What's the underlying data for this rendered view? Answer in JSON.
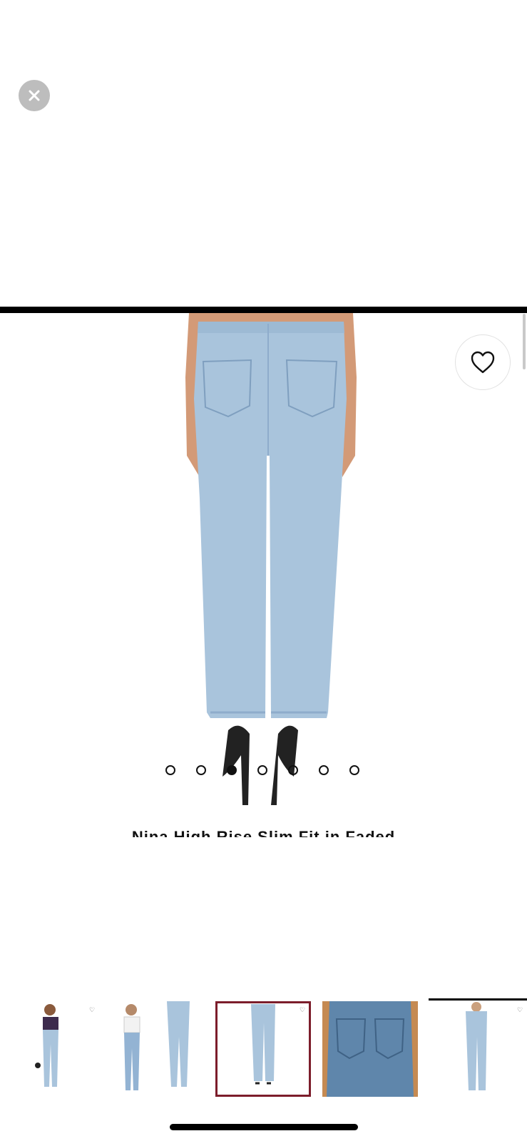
{
  "viewer": {
    "close_icon": "close-icon",
    "favorite_icon": "heart-outline-icon",
    "image_count": 7,
    "active_index": 2
  },
  "product": {
    "title": "Nina High Rise Slim Fit in Faded"
  },
  "thumbnails": {
    "items": [
      {
        "name": "thumbnail-1",
        "has_heart_tag": true,
        "selected": false
      },
      {
        "name": "thumbnail-2",
        "has_heart_tag": false,
        "selected": false
      },
      {
        "name": "thumbnail-3",
        "has_heart_tag": false,
        "selected": false
      },
      {
        "name": "thumbnail-4",
        "has_heart_tag": true,
        "selected": true
      },
      {
        "name": "thumbnail-5",
        "has_heart_tag": false,
        "selected": false
      },
      {
        "name": "thumbnail-6",
        "has_heart_tag": true,
        "selected": false
      }
    ]
  },
  "colors": {
    "selected_border": "#7c1d2b",
    "denim": "#a9c4dc",
    "skin": "#d39a77"
  }
}
